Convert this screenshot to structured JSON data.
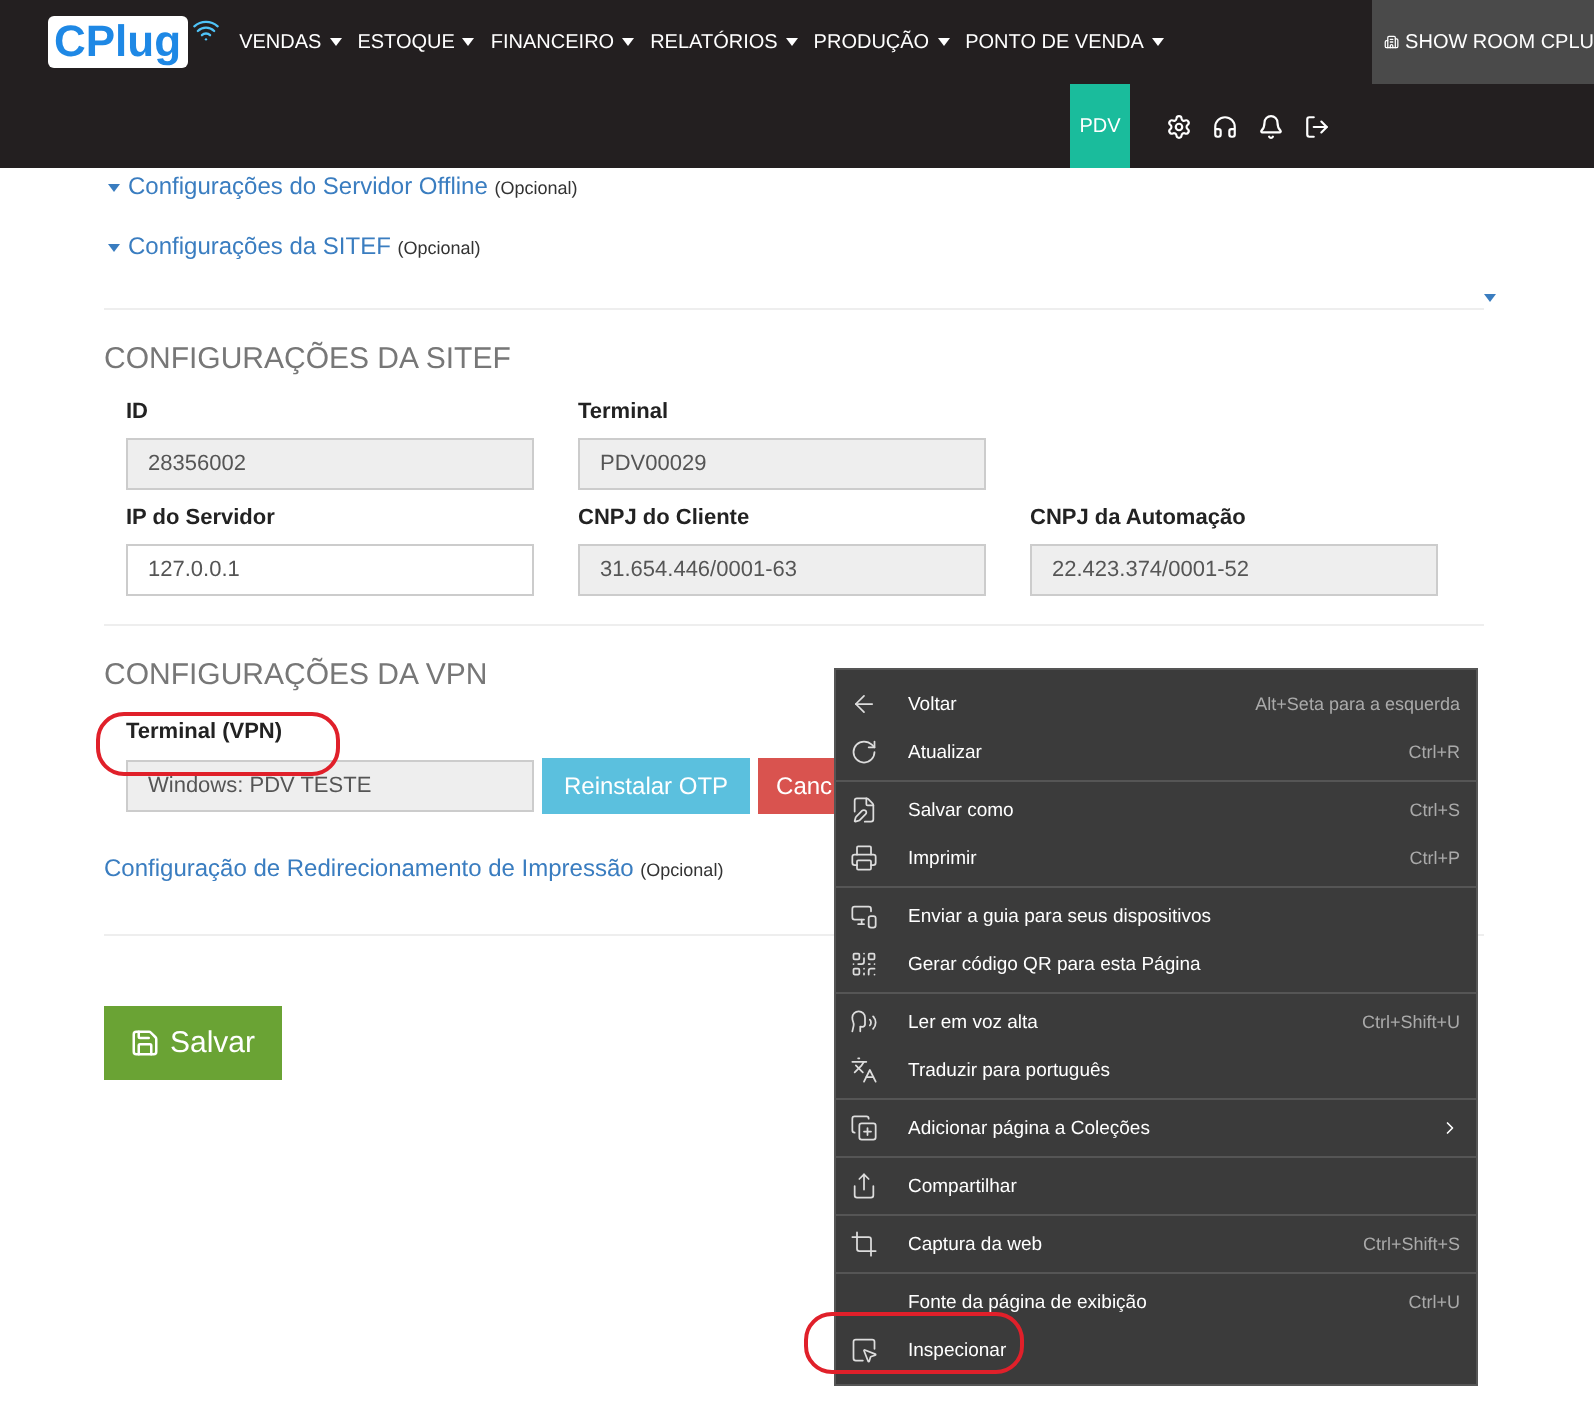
{
  "navbar": {
    "logo": "CPlug",
    "menus": [
      "VENDAS",
      "ESTOQUE",
      "FINANCEIRO",
      "RELATÓRIOS",
      "PRODUÇÃO",
      "PONTO DE VENDA"
    ],
    "store": "SHOW ROOM CPLU",
    "pdv": "PDV"
  },
  "links": [
    {
      "label": "Configurações do Servidor Offline",
      "note": "(Opcional)"
    },
    {
      "label": "Configurações da SITEF",
      "note": "(Opcional)"
    }
  ],
  "sitef": {
    "title": "CONFIGURAÇÕES DA SITEF",
    "rows": [
      [
        {
          "label": "ID",
          "value": "28356002",
          "disabled": true
        },
        {
          "label": "Terminal",
          "value": "PDV00029",
          "disabled": true
        }
      ],
      [
        {
          "label": "IP do Servidor",
          "value": "127.0.0.1",
          "disabled": false
        },
        {
          "label": "CNPJ do Cliente",
          "value": "31.654.446/0001-63",
          "disabled": true
        },
        {
          "label": "CNPJ da Automação",
          "value": "22.423.374/0001-52",
          "disabled": true
        }
      ]
    ]
  },
  "vpn": {
    "title": "CONFIGURAÇÕES DA VPN",
    "label": "Terminal (VPN)",
    "value": "Windows: PDV TESTE",
    "buttons": [
      {
        "label": "Reinstalar OTP",
        "kind": "info"
      },
      {
        "label": "Canc",
        "kind": "danger"
      }
    ]
  },
  "print_link": {
    "label": "Configuração de Redirecionamento de Impressão",
    "note": "(Opcional)"
  },
  "save": "Salvar",
  "context_menu": [
    [
      {
        "label": "Voltar",
        "shortcut": "Alt+Seta para a esquerda"
      },
      {
        "label": "Atualizar",
        "shortcut": "Ctrl+R"
      }
    ],
    [
      {
        "label": "Salvar como",
        "shortcut": "Ctrl+S"
      },
      {
        "label": "Imprimir",
        "shortcut": "Ctrl+P"
      }
    ],
    [
      {
        "label": "Enviar a guia para seus dispositivos"
      },
      {
        "label": "Gerar código QR para esta Página"
      }
    ],
    [
      {
        "label": "Ler em voz alta",
        "shortcut": "Ctrl+Shift+U"
      },
      {
        "label": "Traduzir para português"
      }
    ],
    [
      {
        "label": "Adicionar página a Coleções",
        "submenu": true
      }
    ],
    [
      {
        "label": "Compartilhar"
      }
    ],
    [
      {
        "label": "Captura da web",
        "shortcut": "Ctrl+Shift+S"
      }
    ],
    [
      {
        "label": "Fonte da página de exibição",
        "shortcut": "Ctrl+U"
      },
      {
        "label": "Inspecionar"
      }
    ]
  ]
}
